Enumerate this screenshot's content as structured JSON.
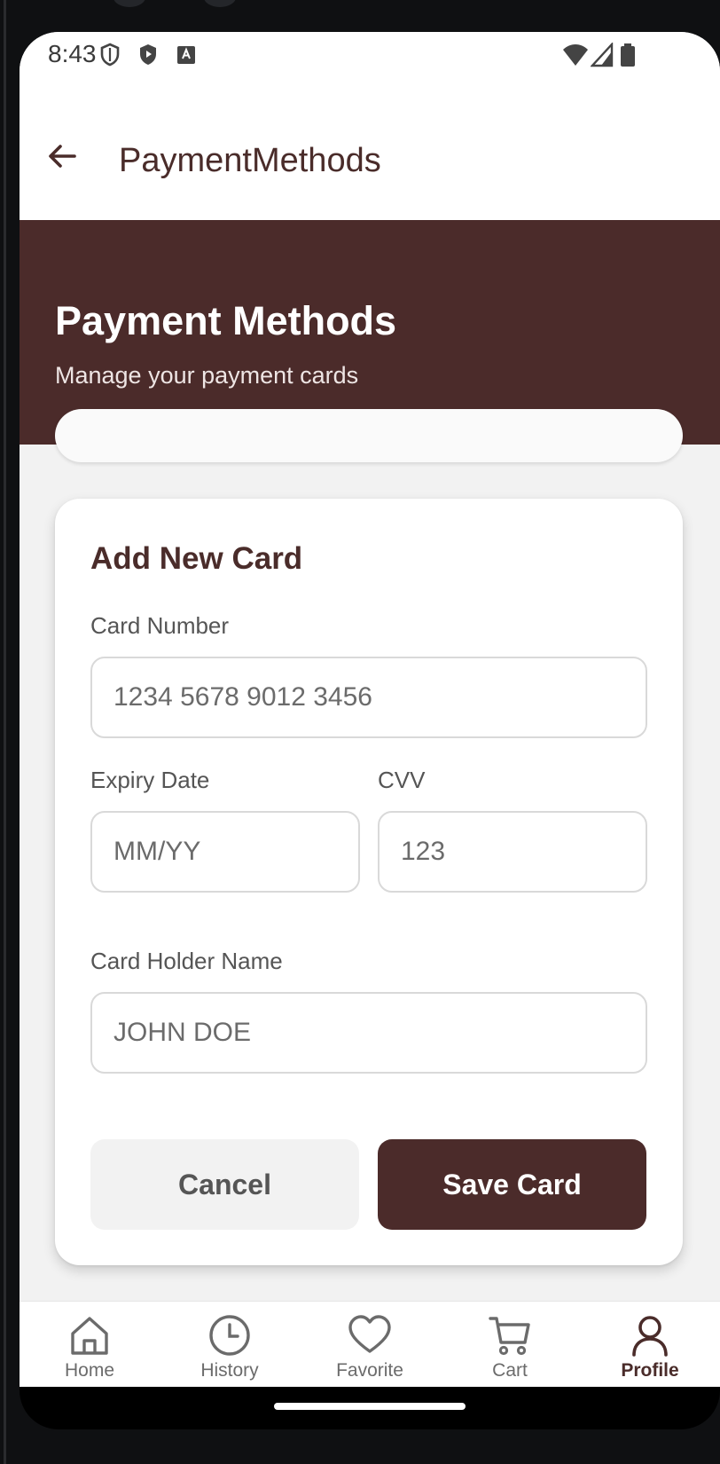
{
  "status_bar": {
    "time": "8:43"
  },
  "app_bar": {
    "title": "PaymentMethods"
  },
  "header": {
    "title": "Payment Methods",
    "subtitle": "Manage your payment cards"
  },
  "form": {
    "title": "Add New Card",
    "card_number": {
      "label": "Card Number",
      "placeholder": "1234 5678 9012 3456"
    },
    "expiry": {
      "label": "Expiry Date",
      "placeholder": "MM/YY"
    },
    "cvv": {
      "label": "CVV",
      "placeholder": "123"
    },
    "holder": {
      "label": "Card Holder Name",
      "placeholder": "JOHN DOE"
    },
    "cancel_label": "Cancel",
    "save_label": "Save Card"
  },
  "bottom_nav": {
    "items": [
      {
        "label": "Home",
        "icon": "home-icon"
      },
      {
        "label": "History",
        "icon": "clock-icon"
      },
      {
        "label": "Favorite",
        "icon": "heart-icon"
      },
      {
        "label": "Cart",
        "icon": "cart-icon"
      },
      {
        "label": "Profile",
        "icon": "profile-icon",
        "active": true
      }
    ]
  },
  "colors": {
    "brand": "#4b2b2a",
    "background": "#f2f2f2",
    "card": "#ffffff",
    "muted_text": "#6b6b6b"
  }
}
